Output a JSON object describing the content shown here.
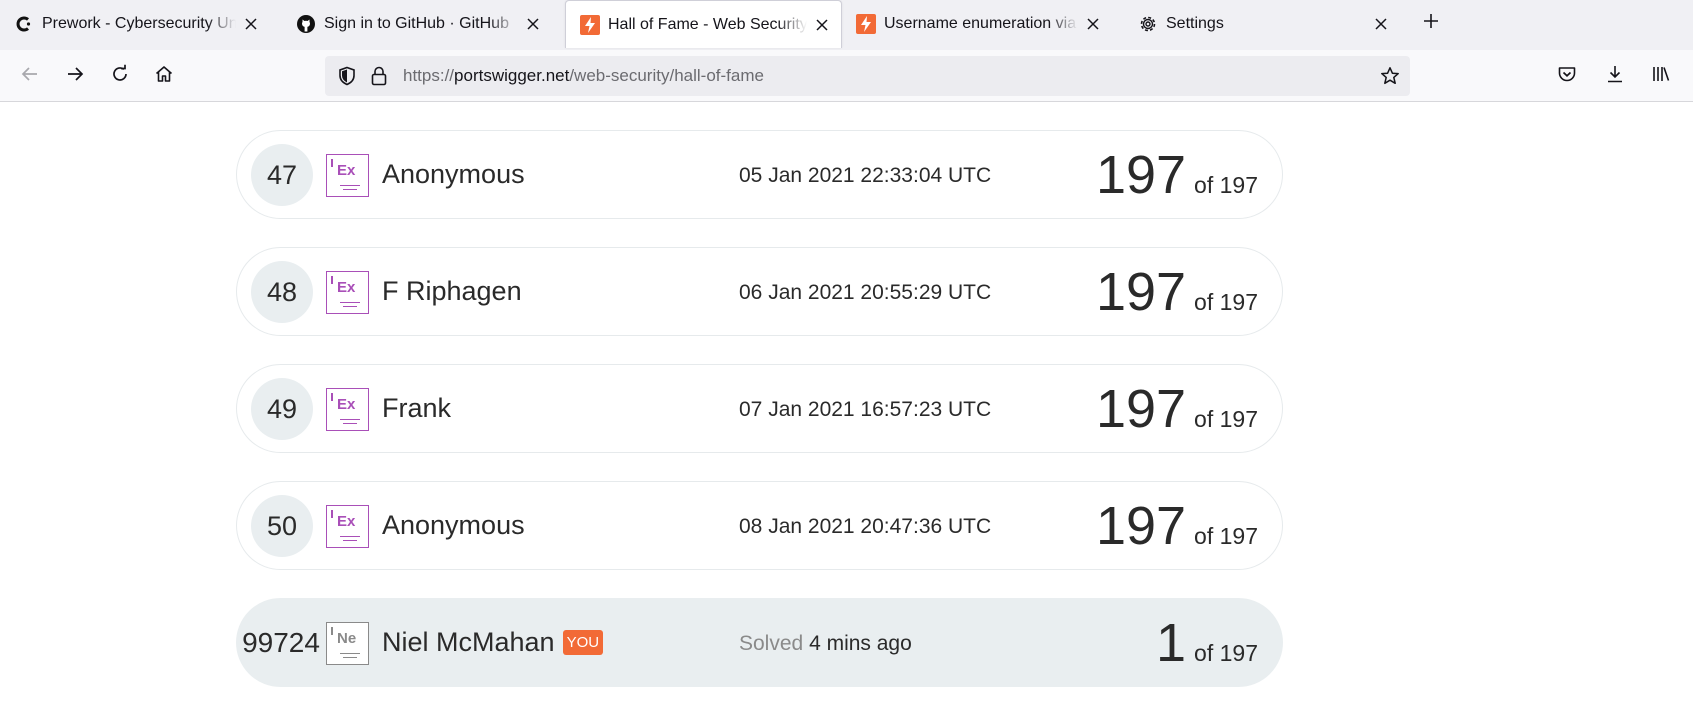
{
  "browser": {
    "tabs": [
      {
        "title": "Prework - Cybersecurity University",
        "icon": "codepath-icon"
      },
      {
        "title": "Sign in to GitHub · GitHub",
        "icon": "github-icon"
      },
      {
        "title": "Hall of Fame - Web Security Academy",
        "icon": "portswigger-icon",
        "active": true
      },
      {
        "title": "Username enumeration via different responses",
        "icon": "portswigger-icon"
      },
      {
        "title": "Settings",
        "icon": "gear-icon"
      }
    ],
    "url_scheme": "https://",
    "url_host": "portswigger.net",
    "url_path": "/web-security/hall-of-fame"
  },
  "leaderboard": {
    "rows": [
      {
        "rank": "47",
        "avatar": "Ex",
        "name": "Anonymous",
        "date": "05 Jan 2021 22:33:04 UTC",
        "score": "197",
        "of": "of 197"
      },
      {
        "rank": "48",
        "avatar": "Ex",
        "name": "F Riphagen",
        "date": "06 Jan 2021 20:55:29 UTC",
        "score": "197",
        "of": "of 197"
      },
      {
        "rank": "49",
        "avatar": "Ex",
        "name": "Frank",
        "date": "07 Jan 2021 16:57:23 UTC",
        "score": "197",
        "of": "of 197"
      },
      {
        "rank": "50",
        "avatar": "Ex",
        "name": "Anonymous",
        "date": "08 Jan 2021 20:47:36 UTC",
        "score": "197",
        "of": "of 197"
      }
    ],
    "you": {
      "rank": "99724",
      "avatar": "Ne",
      "name": "Niel McMahan",
      "badge": "YOU",
      "solved_label": "Solved",
      "solved_time": "4 mins ago",
      "score": "1",
      "of": "of 197"
    }
  },
  "colors": {
    "accent_orange": "#f26a36",
    "avatar_purple": "#a94fb8",
    "row_highlight": "#e9eef0"
  }
}
